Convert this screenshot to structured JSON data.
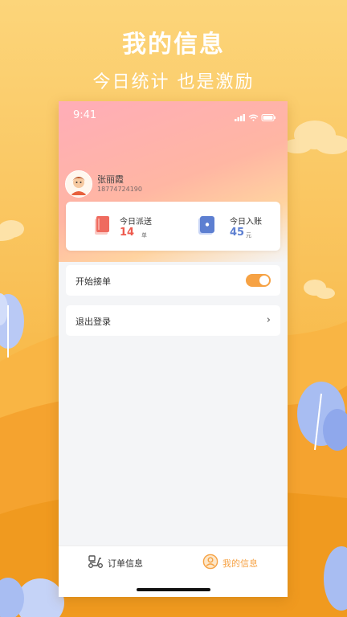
{
  "promo": {
    "title": "我的信息",
    "subtitle": "今日统计  也是激励"
  },
  "status_bar": {
    "time": "9:41"
  },
  "profile": {
    "name": "张丽霞",
    "phone": "18774724190"
  },
  "stats": {
    "deliveries": {
      "label": "今日派送",
      "value": "14",
      "unit": "单"
    },
    "income": {
      "label": "今日入账",
      "value": "45",
      "unit": "元"
    }
  },
  "settings": {
    "accept_orders": {
      "label": "开始接单",
      "enabled": true
    },
    "logout": {
      "label": "退出登录"
    }
  },
  "tabbar": {
    "orders": {
      "label": "订单信息"
    },
    "mine": {
      "label": "我的信息"
    }
  },
  "colors": {
    "accent": "#f6a244",
    "deliveries_value": "#ee5a4d",
    "income_value": "#5d7fd1",
    "tab_inactive": "#333333",
    "tab_active": "#f6a244"
  }
}
